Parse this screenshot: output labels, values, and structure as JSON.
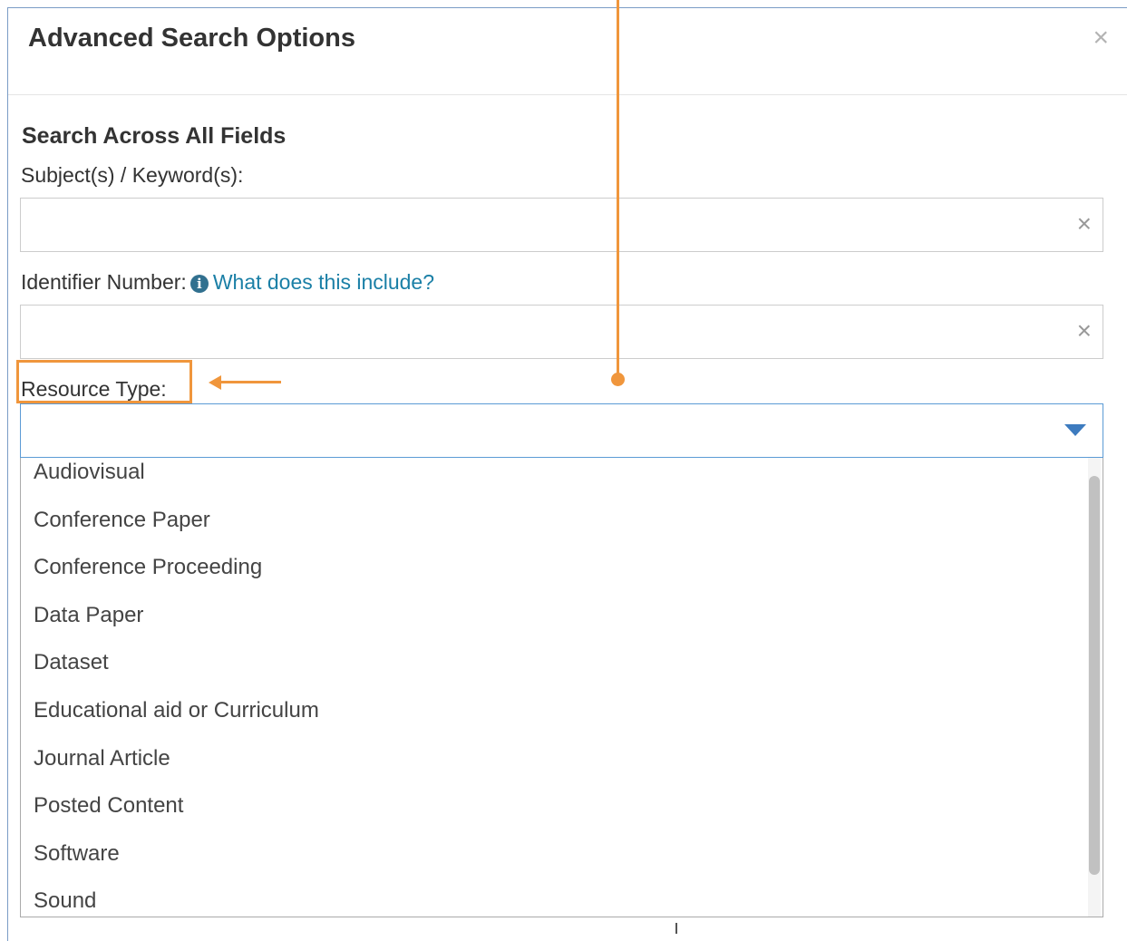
{
  "modal": {
    "title": "Advanced Search Options",
    "close_glyph": "×"
  },
  "form": {
    "section_title": "Search Across All Fields",
    "subjects_label": "Subject(s) / Keyword(s):",
    "subjects_value": "",
    "identifier_label": "Identifier Number:",
    "identifier_help_link": "What does this include?",
    "identifier_value": "",
    "resource_type_label": "Resource Type:",
    "resource_type_selected": "",
    "clear_glyph": "×"
  },
  "dropdown": {
    "options": [
      "Audiovisual",
      "Conference Paper",
      "Conference Proceeding",
      "Data Paper",
      "Dataset",
      "Educational aid or Curriculum",
      "Journal Article",
      "Posted Content",
      "Software",
      "Sound"
    ]
  },
  "icons": {
    "info": "info-circle-icon",
    "close": "close-icon",
    "clear": "clear-x-icon",
    "caret": "caret-down-icon"
  },
  "colors": {
    "annotation": "#f0963c",
    "link": "#1a7fa6",
    "focus_border": "#5b9bd5"
  }
}
